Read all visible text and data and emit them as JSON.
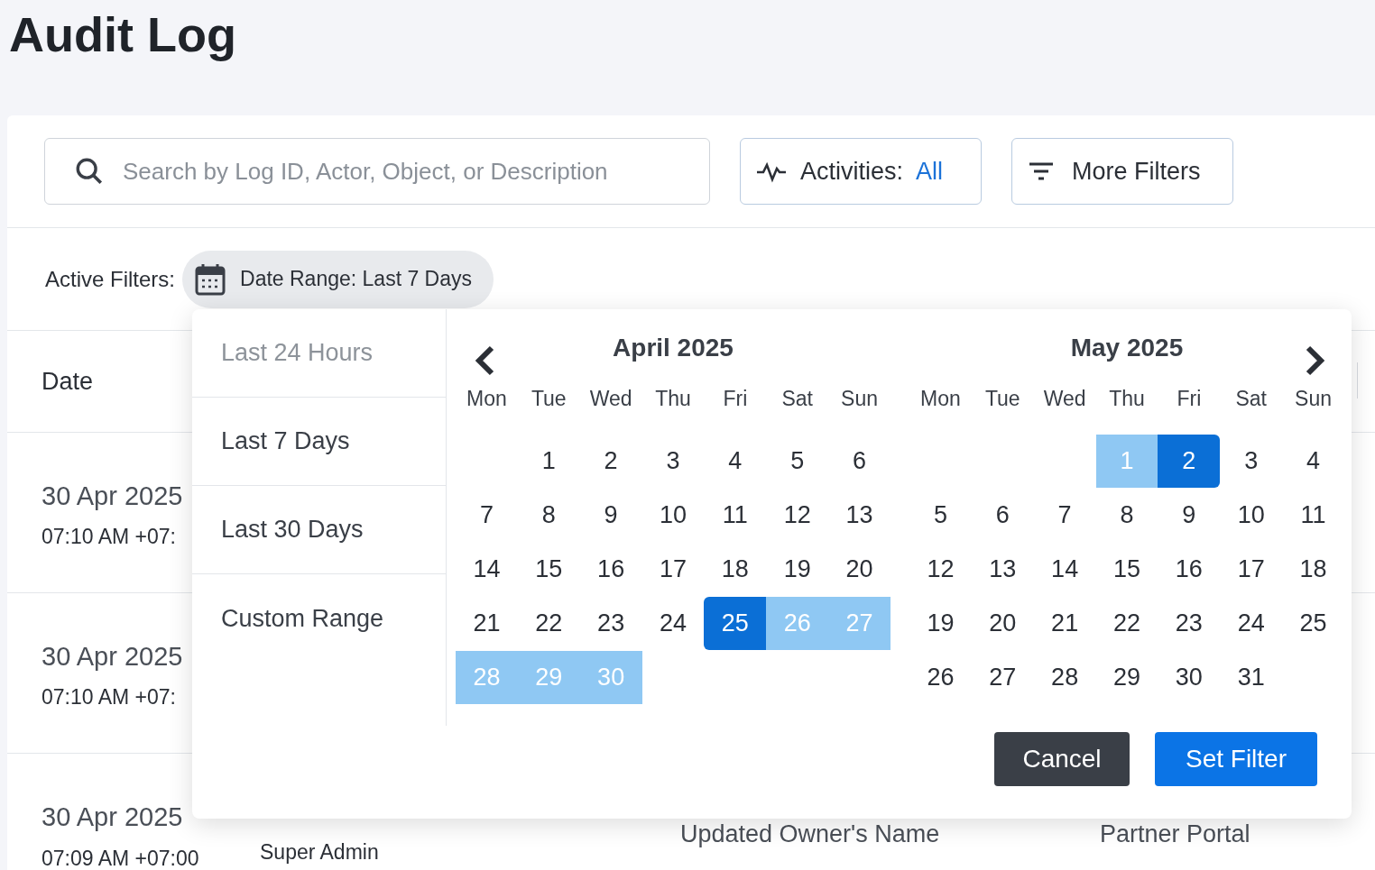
{
  "page": {
    "title": "Audit Log"
  },
  "toolbar": {
    "search": {
      "placeholder": "Search by Log ID, Actor, Object, or Description"
    },
    "activities": {
      "label": "Activities:",
      "value": "All"
    },
    "more_filters": {
      "label": "More Filters"
    }
  },
  "active_filters": {
    "label": "Active Filters:",
    "chips": [
      {
        "label": "Date Range: Last 7 Days"
      }
    ]
  },
  "table": {
    "columns": [
      "Date"
    ],
    "rows": [
      {
        "date": "30 Apr 2025",
        "time": "07:10 AM +07:"
      },
      {
        "date": "30 Apr 2025",
        "time": "07:10 AM +07:"
      },
      {
        "date": "30 Apr 2025",
        "time": "07:09 AM +07:00",
        "role": "Super Admin",
        "description": "Updated Owner's Name",
        "source": "Partner Portal"
      }
    ]
  },
  "date_picker": {
    "presets": [
      {
        "label": "Last 24 Hours",
        "disabled": true
      },
      {
        "label": "Last 7 Days",
        "disabled": false
      },
      {
        "label": "Last 30 Days",
        "disabled": false
      },
      {
        "label": "Custom Range",
        "disabled": false
      }
    ],
    "months": [
      {
        "title": "April 2025",
        "prev_button": true,
        "next_button": false,
        "weekdays": [
          "Mon",
          "Tue",
          "Wed",
          "Thu",
          "Fri",
          "Sat",
          "Sun"
        ],
        "weeks": [
          [
            {
              "kind": "blank"
            },
            {
              "kind": "day",
              "d": "1"
            },
            {
              "kind": "day",
              "d": "2"
            },
            {
              "kind": "day",
              "d": "3"
            },
            {
              "kind": "day",
              "d": "4"
            },
            {
              "kind": "day",
              "d": "5"
            },
            {
              "kind": "day",
              "d": "6"
            }
          ],
          [
            {
              "kind": "day",
              "d": "7"
            },
            {
              "kind": "day",
              "d": "8"
            },
            {
              "kind": "day",
              "d": "9"
            },
            {
              "kind": "day",
              "d": "10"
            },
            {
              "kind": "day",
              "d": "11"
            },
            {
              "kind": "day",
              "d": "12"
            },
            {
              "kind": "day",
              "d": "13"
            }
          ],
          [
            {
              "kind": "day",
              "d": "14"
            },
            {
              "kind": "day",
              "d": "15"
            },
            {
              "kind": "day",
              "d": "16"
            },
            {
              "kind": "day",
              "d": "17"
            },
            {
              "kind": "day",
              "d": "18"
            },
            {
              "kind": "day",
              "d": "19"
            },
            {
              "kind": "day",
              "d": "20"
            }
          ],
          [
            {
              "kind": "day",
              "d": "21"
            },
            {
              "kind": "day",
              "d": "22"
            },
            {
              "kind": "day",
              "d": "23"
            },
            {
              "kind": "day",
              "d": "24"
            },
            {
              "kind": "range_start",
              "d": "25"
            },
            {
              "kind": "in_range",
              "d": "26"
            },
            {
              "kind": "in_range",
              "d": "27"
            }
          ],
          [
            {
              "kind": "in_range",
              "d": "28"
            },
            {
              "kind": "in_range",
              "d": "29"
            },
            {
              "kind": "in_range",
              "d": "30"
            }
          ]
        ]
      },
      {
        "title": "May 2025",
        "prev_button": false,
        "next_button": true,
        "weekdays": [
          "Mon",
          "Tue",
          "Wed",
          "Thu",
          "Fri",
          "Sat",
          "Sun"
        ],
        "weeks": [
          [
            {
              "kind": "blank"
            },
            {
              "kind": "blank"
            },
            {
              "kind": "blank"
            },
            {
              "kind": "in_range",
              "d": "1"
            },
            {
              "kind": "range_end",
              "d": "2"
            },
            {
              "kind": "day",
              "d": "3"
            },
            {
              "kind": "day",
              "d": "4"
            }
          ],
          [
            {
              "kind": "day",
              "d": "5"
            },
            {
              "kind": "day",
              "d": "6"
            },
            {
              "kind": "day",
              "d": "7"
            },
            {
              "kind": "day",
              "d": "8"
            },
            {
              "kind": "day",
              "d": "9"
            },
            {
              "kind": "day",
              "d": "10"
            },
            {
              "kind": "day",
              "d": "11"
            }
          ],
          [
            {
              "kind": "day",
              "d": "12"
            },
            {
              "kind": "day",
              "d": "13"
            },
            {
              "kind": "day",
              "d": "14"
            },
            {
              "kind": "day",
              "d": "15"
            },
            {
              "kind": "day",
              "d": "16"
            },
            {
              "kind": "day",
              "d": "17"
            },
            {
              "kind": "day",
              "d": "18"
            }
          ],
          [
            {
              "kind": "day",
              "d": "19"
            },
            {
              "kind": "day",
              "d": "20"
            },
            {
              "kind": "day",
              "d": "21"
            },
            {
              "kind": "day",
              "d": "22"
            },
            {
              "kind": "day",
              "d": "23"
            },
            {
              "kind": "day",
              "d": "24"
            },
            {
              "kind": "day",
              "d": "25"
            }
          ],
          [
            {
              "kind": "day",
              "d": "26"
            },
            {
              "kind": "day",
              "d": "27"
            },
            {
              "kind": "day",
              "d": "28"
            },
            {
              "kind": "day",
              "d": "29"
            },
            {
              "kind": "day",
              "d": "30"
            },
            {
              "kind": "day",
              "d": "31"
            }
          ]
        ]
      }
    ],
    "buttons": [
      {
        "label": "Cancel",
        "kind": "secondary"
      },
      {
        "label": "Set Filter",
        "kind": "primary"
      }
    ]
  }
}
